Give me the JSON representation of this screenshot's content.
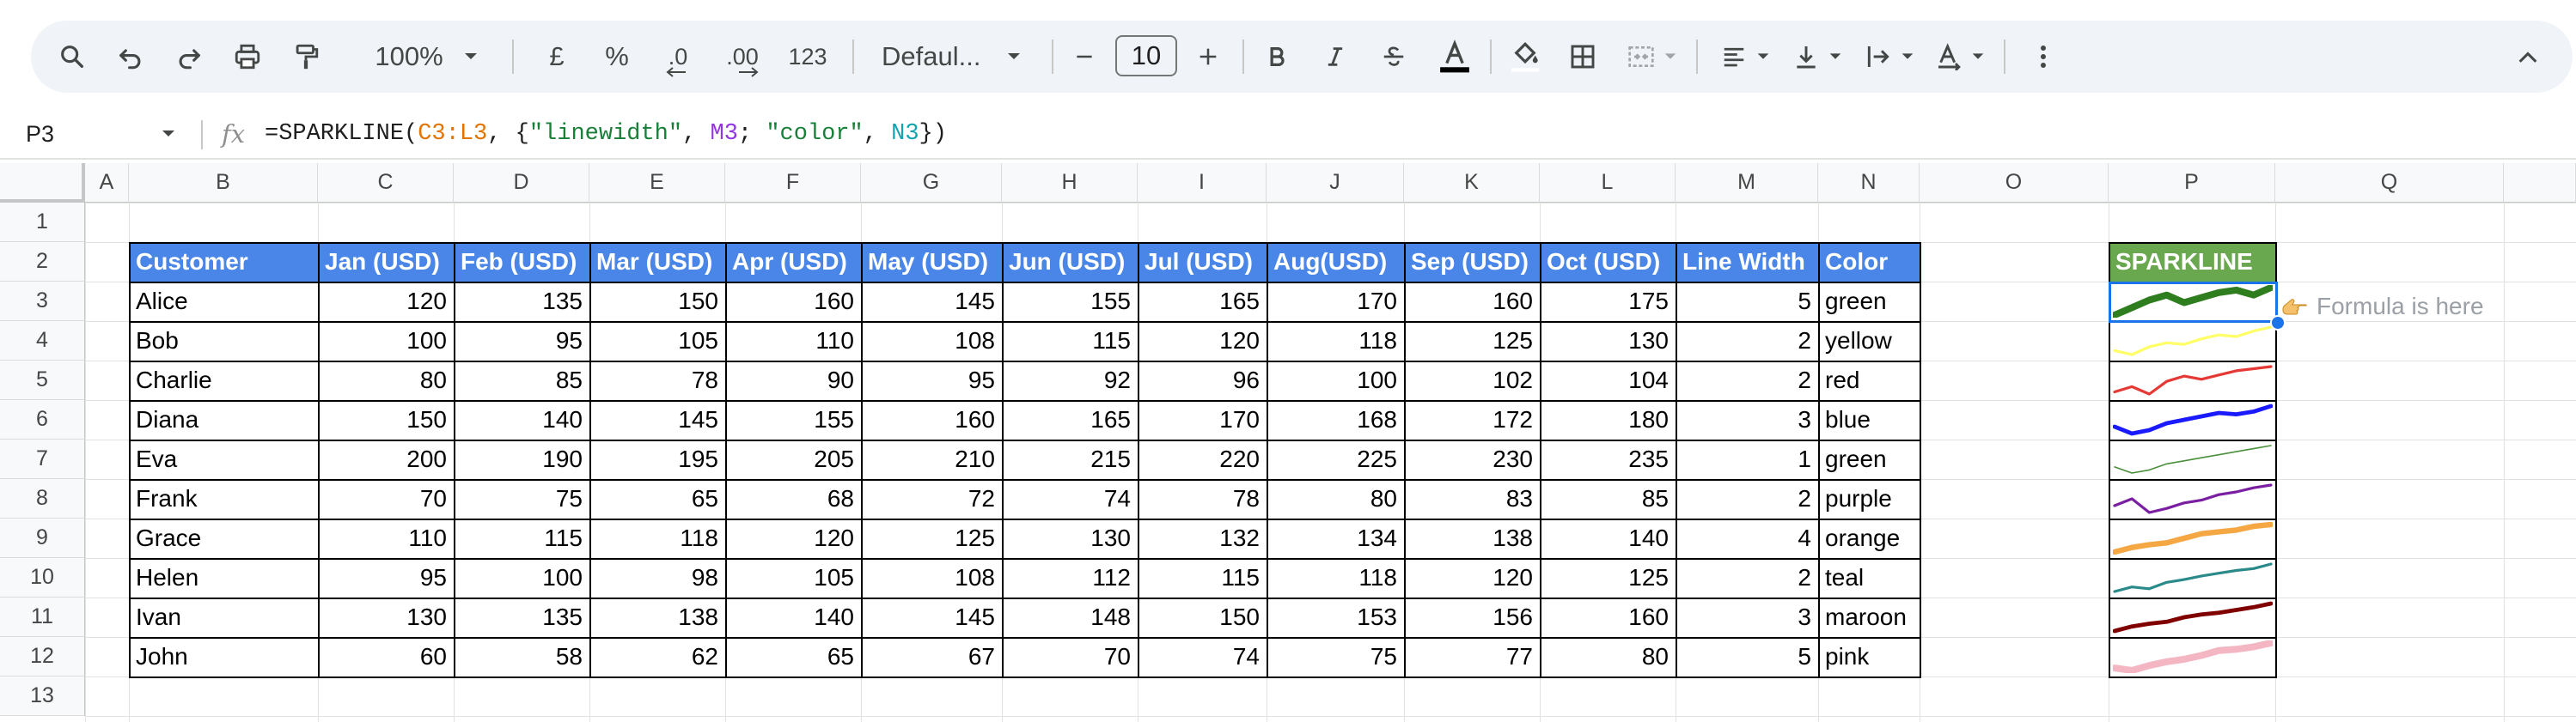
{
  "toolbar": {
    "zoom": "100%",
    "currency": "£",
    "percent": "%",
    "decrease_decimal": ".0",
    "increase_decimal": ".00",
    "number_format": "123",
    "font_name": "Defaul...",
    "font_size": "10",
    "accent_color": "#000000"
  },
  "formula_bar": {
    "cell_ref": "P3",
    "fx": "fx",
    "formula_parts": [
      "=SPARKLINE(",
      "C3:L3",
      ", {",
      "\"linewidth\"",
      ", ",
      "M3",
      "; ",
      "\"color\"",
      ", ",
      "N3",
      "})"
    ]
  },
  "grid": {
    "columns": [
      "A",
      "B",
      "C",
      "D",
      "E",
      "F",
      "G",
      "H",
      "I",
      "J",
      "K",
      "L",
      "M",
      "N",
      "O",
      "P",
      "Q"
    ],
    "rows": [
      "1",
      "2",
      "3",
      "4",
      "5",
      "6",
      "7",
      "8",
      "9",
      "10",
      "11",
      "12",
      "13"
    ]
  },
  "table": {
    "headers": [
      "Customer",
      "Jan (USD)",
      "Feb (USD)",
      "Mar (USD)",
      "Apr (USD)",
      "May (USD)",
      "Jun (USD)",
      "Jul (USD)",
      "Aug(USD)",
      "Sep (USD)",
      "Oct (USD)",
      "Line Width",
      "Color"
    ],
    "rows": [
      [
        "Alice",
        "120",
        "135",
        "150",
        "160",
        "145",
        "155",
        "165",
        "170",
        "160",
        "175",
        "5",
        "green"
      ],
      [
        "Bob",
        "100",
        "95",
        "105",
        "110",
        "108",
        "115",
        "120",
        "118",
        "125",
        "130",
        "2",
        "yellow"
      ],
      [
        "Charlie",
        "80",
        "85",
        "78",
        "90",
        "95",
        "92",
        "96",
        "100",
        "102",
        "104",
        "2",
        "red"
      ],
      [
        "Diana",
        "150",
        "140",
        "145",
        "155",
        "160",
        "165",
        "170",
        "168",
        "172",
        "180",
        "3",
        "blue"
      ],
      [
        "Eva",
        "200",
        "190",
        "195",
        "205",
        "210",
        "215",
        "220",
        "225",
        "230",
        "235",
        "1",
        "green"
      ],
      [
        "Frank",
        "70",
        "75",
        "65",
        "68",
        "72",
        "74",
        "78",
        "80",
        "83",
        "85",
        "2",
        "purple"
      ],
      [
        "Grace",
        "110",
        "115",
        "118",
        "120",
        "125",
        "130",
        "132",
        "134",
        "138",
        "140",
        "4",
        "orange"
      ],
      [
        "Helen",
        "95",
        "100",
        "98",
        "105",
        "108",
        "112",
        "115",
        "118",
        "120",
        "125",
        "2",
        "teal"
      ],
      [
        "Ivan",
        "130",
        "135",
        "138",
        "140",
        "145",
        "148",
        "150",
        "153",
        "156",
        "160",
        "3",
        "maroon"
      ],
      [
        "John",
        "60",
        "58",
        "62",
        "65",
        "67",
        "70",
        "74",
        "75",
        "77",
        "80",
        "5",
        "pink"
      ]
    ]
  },
  "sparkline": {
    "header": "SPARKLINE",
    "note": "Formula is here",
    "colors": {
      "green": "#2e7d1f",
      "yellow": "#ffff66",
      "red": "#e53935",
      "blue": "#1a1aff",
      "purple": "#7b1fa2",
      "orange": "#f4a742",
      "teal": "#2a8a8a",
      "maroon": "#800000",
      "pink": "#f4b6c2"
    },
    "eva_color": "#4a8f3a"
  },
  "colors": {
    "header_blue": "#4a86e8",
    "sparkline_header_green": "#6aa84f",
    "selection_blue": "#1a73e8"
  }
}
